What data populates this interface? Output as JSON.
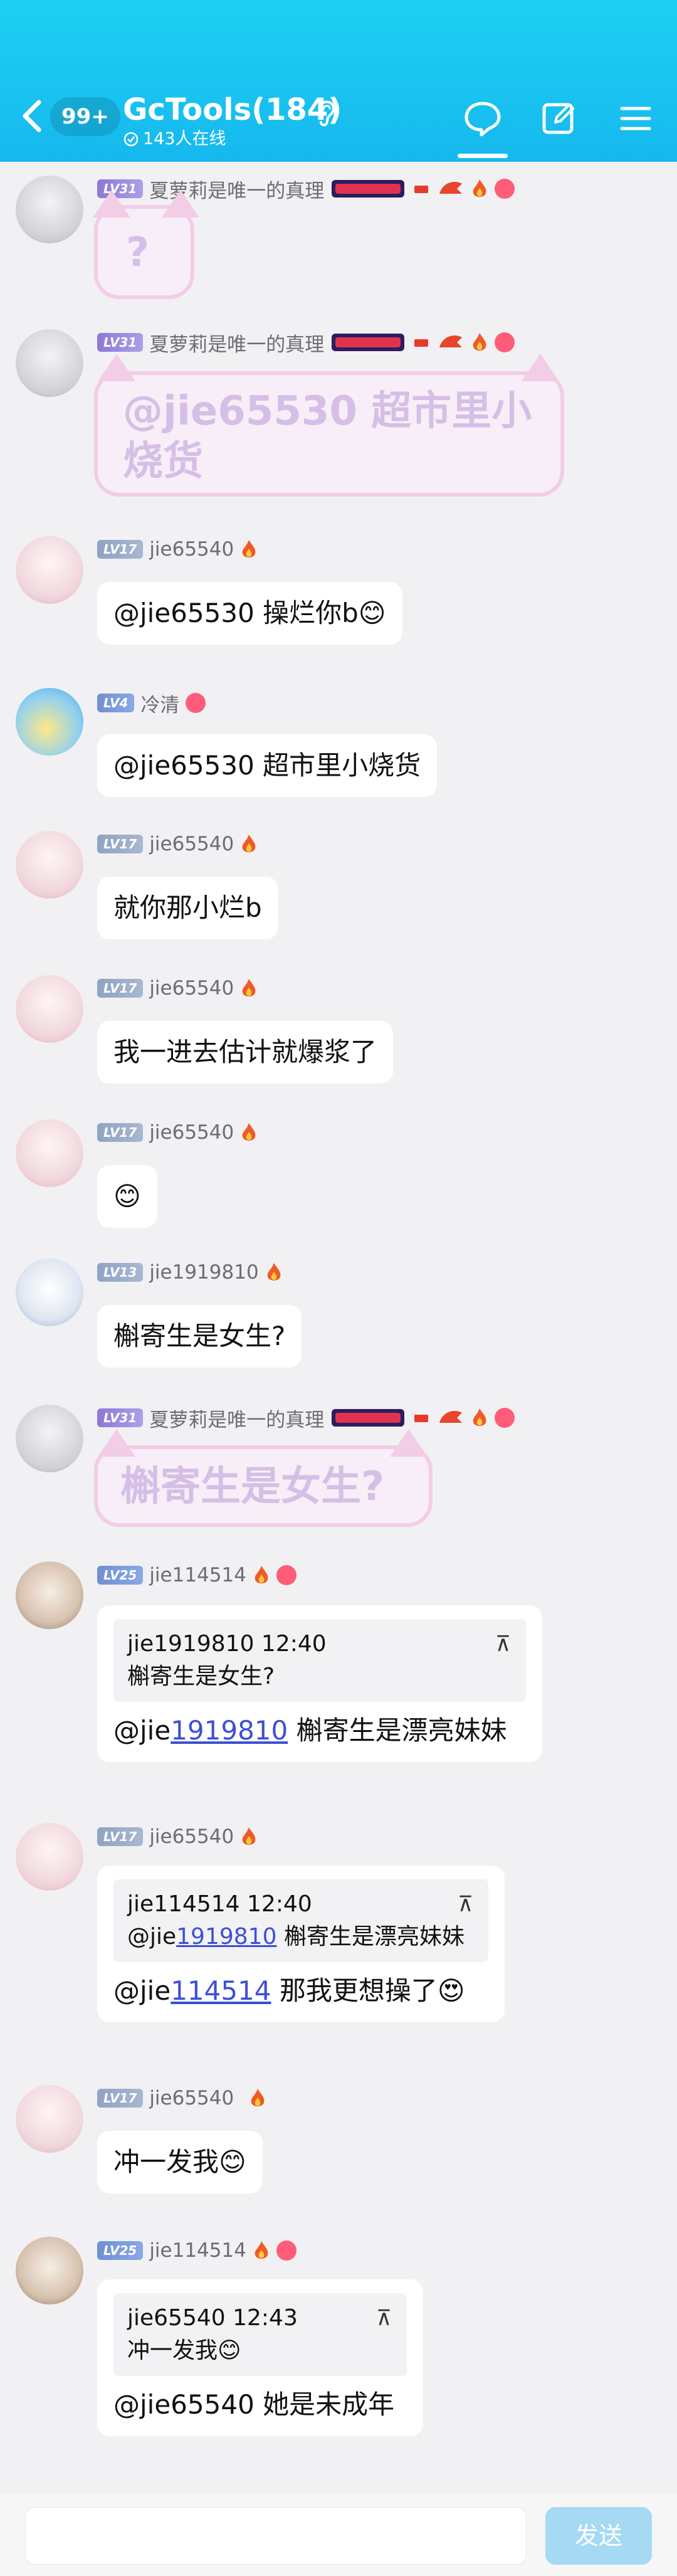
{
  "header": {
    "back_badge": "99+",
    "title": "GcTools(184)",
    "online_text": "143人在线"
  },
  "messages": [
    {
      "type": "sticker",
      "level": "LV31",
      "name": "夏萝莉是唯一的真理",
      "sticker_text": "?"
    },
    {
      "type": "sticker",
      "level": "LV31",
      "name": "夏萝莉是唯一的真理",
      "sticker_text": "@jie65530 超市里小烧货"
    },
    {
      "type": "text",
      "level": "LV17",
      "name": "jie65540",
      "text": "@jie65530 操烂你b😊"
    },
    {
      "type": "text",
      "level": "LV4",
      "name": "冷清",
      "text": "@jie65530 超市里小烧货"
    },
    {
      "type": "text",
      "level": "LV17",
      "name": "jie65540",
      "text": "就你那小烂b"
    },
    {
      "type": "text",
      "level": "LV17",
      "name": "jie65540",
      "text": "我一进去估计就爆浆了"
    },
    {
      "type": "text",
      "level": "LV17",
      "name": "jie65540",
      "text": "😊"
    },
    {
      "type": "text",
      "level": "LV13",
      "name": "jie1919810",
      "text": "槲寄生是女生?"
    },
    {
      "type": "sticker",
      "level": "LV31",
      "name": "夏萝莉是唯一的真理",
      "sticker_text": "槲寄生是女生?"
    },
    {
      "type": "reply",
      "level": "LV25",
      "name": "jie114514",
      "quote_header": "jie1919810 12:40",
      "quote_body": "槲寄生是女生?",
      "reply_prefix": "@jie",
      "reply_link": "1919810",
      "reply_text": " 槲寄生是漂亮妹妹"
    },
    {
      "type": "reply",
      "level": "LV17",
      "name": "jie65540",
      "quote_header": "jie114514 12:40",
      "quote_body_prefix": "@jie",
      "quote_body_link": "1919810",
      "quote_body_rest": " 槲寄生是漂亮妹妹",
      "reply_prefix": "@jie",
      "reply_link": "114514",
      "reply_text": " 那我更想操了😍"
    },
    {
      "type": "text",
      "level": "LV17",
      "name": "jie65540",
      "text": "冲一发我😊"
    },
    {
      "type": "reply",
      "level": "LV25",
      "name": "jie114514",
      "quote_header": "jie65540 12:43",
      "quote_body": "冲一发我😊",
      "reply_prefix": "@jie65540",
      "reply_text": " 她是未成年"
    }
  ],
  "quote_pin_glyph": "⊼",
  "footer": {
    "send_label": "发送",
    "input_placeholder": ""
  },
  "colors": {
    "header": "#1dd0f2",
    "link": "#3d4fd6",
    "bubble": "#ffffff",
    "send": "#a6daf4"
  }
}
